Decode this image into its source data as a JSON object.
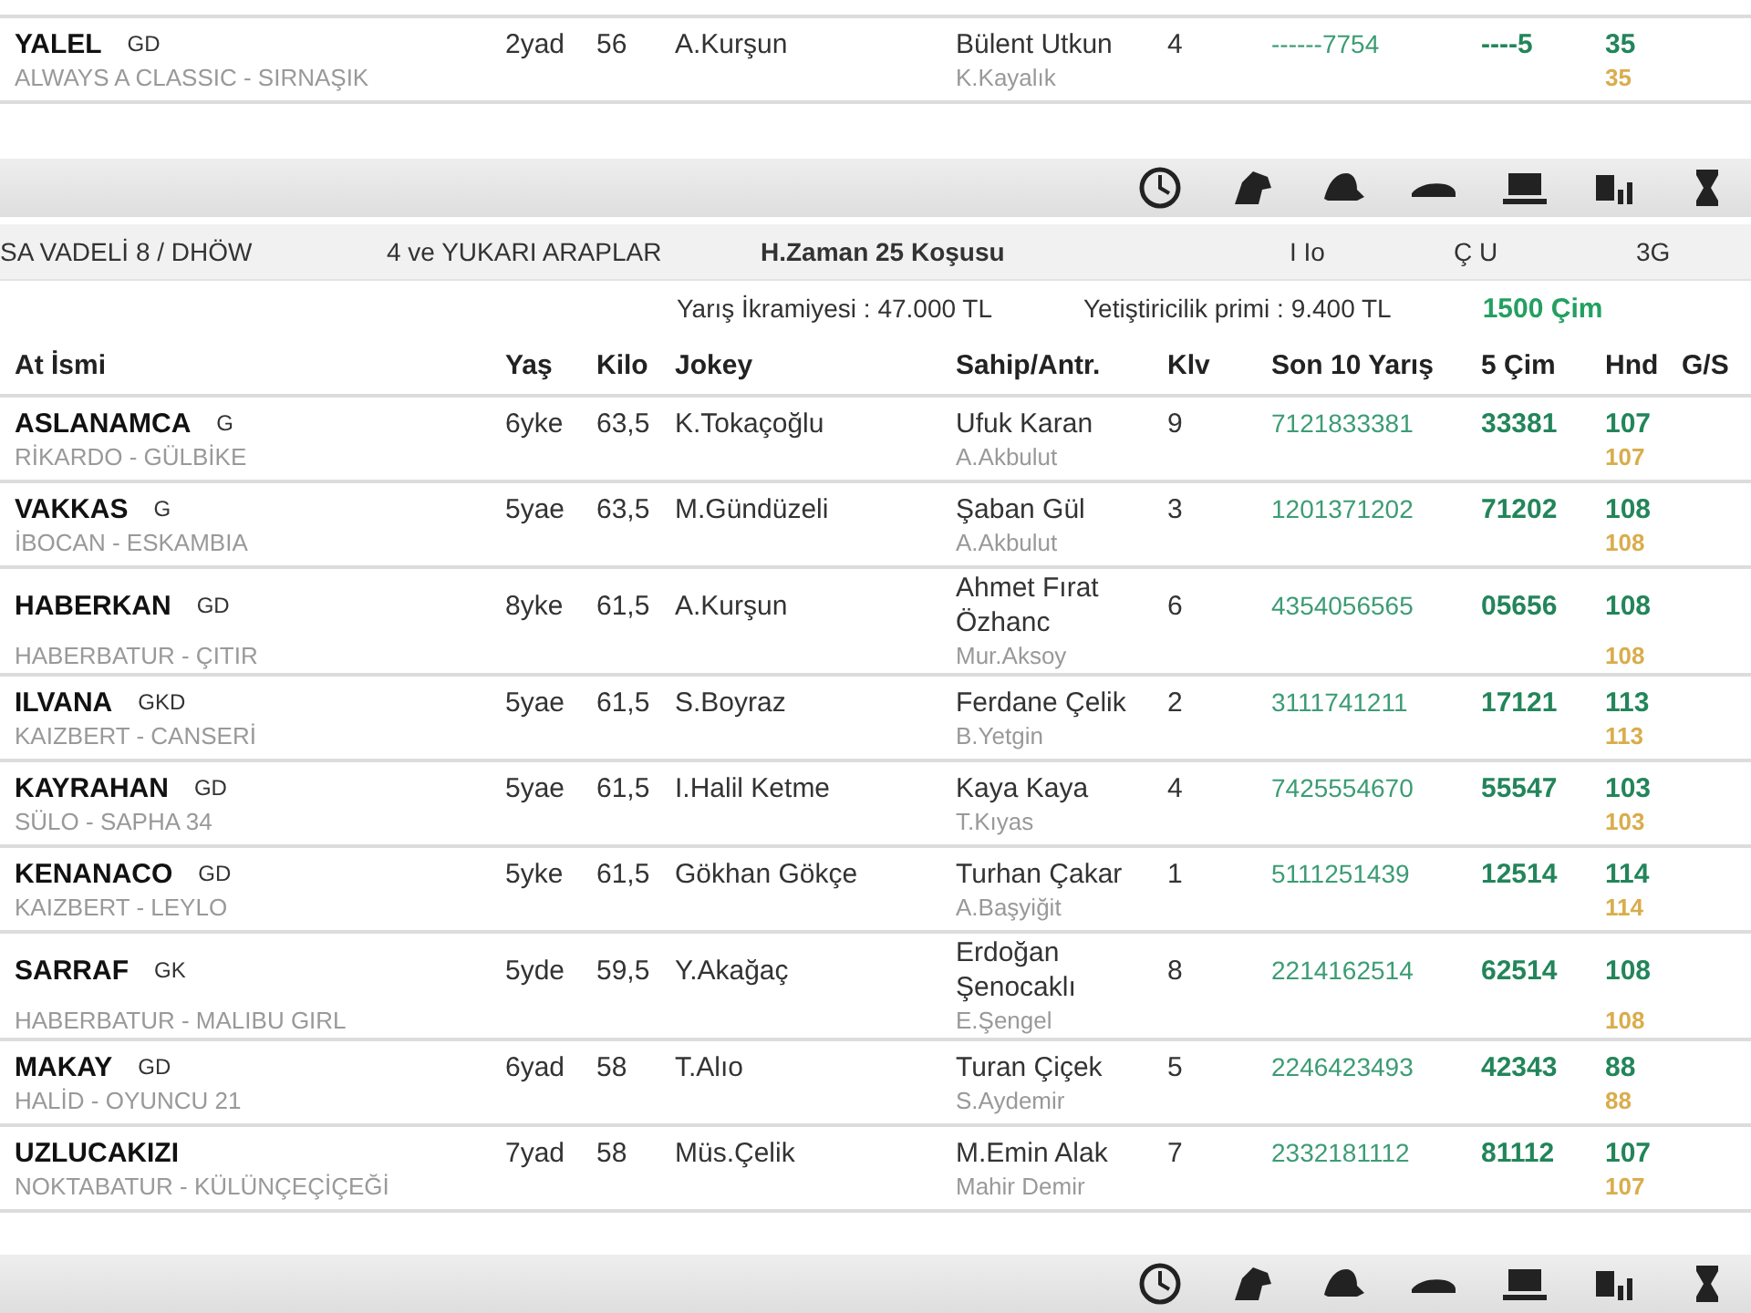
{
  "previous_race": {
    "rows": [
      {
        "name": "YALEL",
        "gender": "GD",
        "pedigree": "ALWAYS A CLASSIC - SIRNAŞIK",
        "age": "2yad",
        "weight": "56",
        "jockey": "A.Kurşun",
        "owner": "Bülent Utkun",
        "trainer": "K.Kayalık",
        "klv": "4",
        "son10": "------7754",
        "cim5": "----5",
        "hnd": "35",
        "hnd2": "35"
      }
    ]
  },
  "race": {
    "title": "SA VADELİ 8 / DHÖW",
    "category": "4 ve YUKARI ARAPLAR",
    "name": "H.Zaman 25 Koşusu",
    "codes": [
      "I Io",
      "Ç U",
      "3G"
    ],
    "prize": "Yarış İkramiyesi : 47.000 TL",
    "breeder_bonus": "Yetiştiricilik primi : 9.400 TL",
    "distance": "1500 Çim"
  },
  "columns": [
    "At İsmi",
    "Yaş",
    "Kilo",
    "Jokey",
    "Sahip/Antr.",
    "Klv",
    "Son 10 Yarış",
    "5 Çim",
    "Hnd",
    "G/S"
  ],
  "rows": [
    {
      "name": "ASLANAMCA",
      "gender": "G",
      "pedigree": "RİKARDO - GÜLBİKE",
      "age": "6yke",
      "weight": "63,5",
      "jockey": "K.Tokaçoğlu",
      "owner": "Ufuk Karan",
      "trainer": "A.Akbulut",
      "klv": "9",
      "son10": "7121833381",
      "cim5": "33381",
      "hnd": "107",
      "hnd2": "107"
    },
    {
      "name": "VAKKAS",
      "gender": "G",
      "pedigree": "İBOCAN - ESKAMBIA",
      "age": "5yae",
      "weight": "63,5",
      "jockey": "M.Gündüzeli",
      "owner": "Şaban Gül",
      "trainer": "A.Akbulut",
      "klv": "3",
      "son10": "1201371202",
      "cim5": "71202",
      "hnd": "108",
      "hnd2": "108"
    },
    {
      "name": "HABERKAN",
      "gender": "GD",
      "pedigree": "HABERBATUR - ÇITIR",
      "age": "8yke",
      "weight": "61,5",
      "jockey": "A.Kurşun",
      "owner": "Ahmet Fırat Özhanc",
      "trainer": "Mur.Aksoy",
      "klv": "6",
      "son10": "4354056565",
      "cim5": "05656",
      "hnd": "108",
      "hnd2": "108"
    },
    {
      "name": "ILVANA",
      "gender": "GKD",
      "pedigree": "KAIZBERT - CANSERİ",
      "age": "5yae",
      "weight": "61,5",
      "jockey": "S.Boyraz",
      "owner": "Ferdane Çelik",
      "trainer": "B.Yetgin",
      "klv": "2",
      "son10": "3111741211",
      "cim5": "17121",
      "hnd": "113",
      "hnd2": "113"
    },
    {
      "name": "KAYRAHAN",
      "gender": "GD",
      "pedigree": "SÜLO - SAPHA 34",
      "age": "5yae",
      "weight": "61,5",
      "jockey": "I.Halil Ketme",
      "owner": "Kaya Kaya",
      "trainer": "T.Kıyas",
      "klv": "4",
      "son10": "7425554670",
      "cim5": "55547",
      "hnd": "103",
      "hnd2": "103"
    },
    {
      "name": "KENANACO",
      "gender": "GD",
      "pedigree": "KAIZBERT - LEYLO",
      "age": "5yke",
      "weight": "61,5",
      "jockey": "Gökhan Gökçe",
      "owner": "Turhan Çakar",
      "trainer": "A.Başyiğit",
      "klv": "1",
      "son10": "5111251439",
      "cim5": "12514",
      "hnd": "114",
      "hnd2": "114"
    },
    {
      "name": "SARRAF",
      "gender": "GK",
      "pedigree": "HABERBATUR - MALIBU GIRL",
      "age": "5yde",
      "weight": "59,5",
      "jockey": "Y.Akağaç",
      "owner": "Erdoğan Şenocaklı",
      "trainer": "E.Şengel",
      "klv": "8",
      "son10": "2214162514",
      "cim5": "62514",
      "hnd": "108",
      "hnd2": "108"
    },
    {
      "name": "MAKAY",
      "gender": "GD",
      "pedigree": "HALİD - OYUNCU 21",
      "age": "6yad",
      "weight": "58",
      "jockey": "T.Alıo",
      "owner": "Turan Çiçek",
      "trainer": "S.Aydemir",
      "klv": "5",
      "son10": "2246423493",
      "cim5": "42343",
      "hnd": "88",
      "hnd2": "88"
    },
    {
      "name": "UZLUCAKIZI",
      "pedigree": "NOKTABATUR - KÜLÜNÇEÇİÇEĞİ",
      "age": "7yad",
      "weight": "58",
      "jockey": "Müs.Çelik",
      "owner": "M.Emin Alak",
      "trainer": "Mahir Demir",
      "klv": "7",
      "son10": "2332181112",
      "cim5": "81112",
      "hnd": "107",
      "hnd2": "107"
    }
  ]
}
